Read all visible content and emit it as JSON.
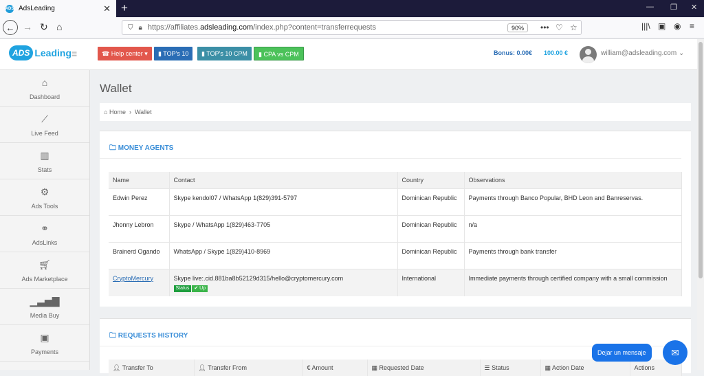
{
  "browser": {
    "tab_title": "AdsLeading",
    "tab_favicon": "ADS",
    "url_prefix": "https://affiliates.",
    "url_domain": "adsleading.com",
    "url_path": "/index.php?content=transferrequests",
    "zoom": "90%"
  },
  "header": {
    "logo_ads": "ADS",
    "logo_leading": "Leading",
    "buttons": [
      {
        "label": "Help center ▾",
        "color": "#e2574c"
      },
      {
        "label": "TOP's 10",
        "color": "#2a6db5"
      },
      {
        "label": "TOP's 10 CPM",
        "color": "#3b8fa6"
      },
      {
        "label": "CPA vs CPM",
        "color": "#4cc25a"
      }
    ],
    "bonus": "Bonus: 0.00€",
    "balance": "100.00 €",
    "user": "william@adsleading.com"
  },
  "sidebar": {
    "items": [
      {
        "label": "Dashboard",
        "icon": "home-icon"
      },
      {
        "label": "Live Feed",
        "icon": "line-chart-icon"
      },
      {
        "label": "Stats",
        "icon": "bar-chart-icon"
      },
      {
        "label": "Ads Tools",
        "icon": "gears-icon"
      },
      {
        "label": "AdsLinks",
        "icon": "link-icon"
      },
      {
        "label": "Ads Marketplace",
        "icon": "cart-icon"
      },
      {
        "label": "Media Buy",
        "icon": "signal-icon"
      },
      {
        "label": "Payments",
        "icon": "money-icon"
      }
    ]
  },
  "page": {
    "title": "Wallet",
    "breadcrumb_home": "Home",
    "breadcrumb_current": "Wallet"
  },
  "money_agents": {
    "title": "MONEY AGENTS",
    "columns": [
      "Name",
      "Contact",
      "Country",
      "Observations"
    ],
    "rows": [
      {
        "name": "Edwin Perez",
        "contact": "Skype kendol07 / WhatsApp 1(829)391-5797",
        "country": "Dominican Republic",
        "observations": "Payments through Banco Popular, BHD Leon and Banreservas."
      },
      {
        "name": "Jhonny Lebron",
        "contact": "Skype / WhatsApp 1(829)463-7705",
        "country": "Dominican Republic",
        "observations": "n/a"
      },
      {
        "name": "Brainerd Ogando",
        "contact": "WhatsApp / Skype 1(829)410-8969",
        "country": "Dominican Republic",
        "observations": "Payments through bank transfer"
      },
      {
        "name": "CryptoMercury",
        "contact": "Skype live:.cid.881ba8b52129d315/hello@cryptomercury.com",
        "country": "International",
        "observations": "Immediate payments through certified company with a small commission",
        "status_label": "Status",
        "status_value": "✔ Up"
      }
    ]
  },
  "requests_history": {
    "title": "REQUESTS HISTORY",
    "columns": [
      "Transfer To",
      "Transfer From",
      "Amount",
      "Requested Date",
      "Status",
      "Action Date",
      "Actions"
    ]
  },
  "chat": {
    "label": "Dejar un mensaje"
  }
}
